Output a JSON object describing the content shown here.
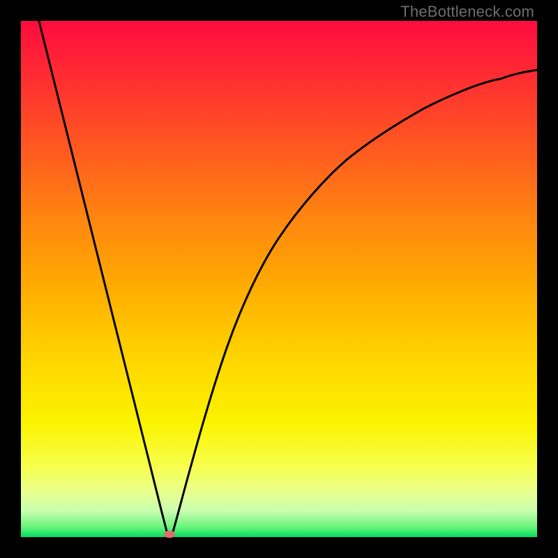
{
  "watermark": "TheBottleneck.com",
  "chart_data": {
    "type": "line",
    "title": "",
    "xlabel": "",
    "ylabel": "",
    "xlim": [
      0,
      100
    ],
    "ylim": [
      0,
      100
    ],
    "grid": false,
    "legend": null,
    "series": [
      {
        "name": "left-branch",
        "x": [
          3.5,
          6,
          9,
          12,
          15,
          18,
          21,
          24,
          26,
          27.5,
          28.4
        ],
        "y": [
          100,
          90,
          78,
          66,
          54,
          42,
          30,
          18,
          10,
          4,
          0.5
        ]
      },
      {
        "name": "right-branch",
        "x": [
          29.3,
          31,
          33,
          36,
          40,
          45,
          50,
          56,
          63,
          70,
          78,
          86,
          93,
          100
        ],
        "y": [
          0.5,
          6,
          14,
          25,
          37,
          49,
          58,
          66,
          73,
          78.5,
          83,
          86.5,
          88.8,
          90.5
        ]
      }
    ],
    "marker": {
      "x": 28.8,
      "y": 0.6
    },
    "background_gradient": {
      "top": "#ff0b3f",
      "bottom": "#00e05c",
      "stops": [
        "red",
        "orange",
        "yellow",
        "green"
      ]
    }
  }
}
